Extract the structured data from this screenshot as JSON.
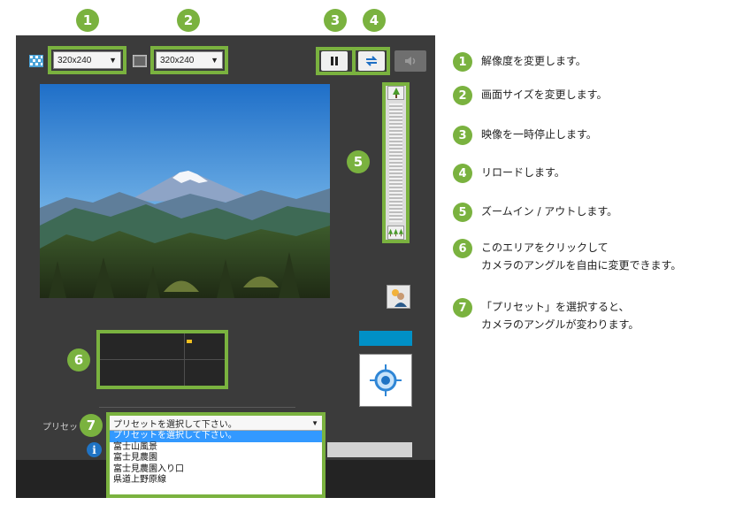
{
  "colors": {
    "accent": "#7ab23f",
    "panel": "#3b3b3b",
    "preset_highlight": "#3399ff",
    "status_bar": "#0090c6"
  },
  "badges": [
    "1",
    "2",
    "3",
    "4",
    "5",
    "6",
    "7"
  ],
  "toolbar": {
    "resolution_value": "320x240",
    "screen_size_value": "320x240",
    "pause_icon": "pause-icon",
    "reload_icon": "reload-icon",
    "sound_icon": "speaker-icon"
  },
  "zoom": {
    "in_icon": "single-tree-icon",
    "out_icon": "three-trees-icon"
  },
  "preset": {
    "label": "プリセット：",
    "selected": "プリセットを選択して下さい。",
    "options": [
      "プリセットを選択して下さい。",
      "富士山風景",
      "富士見農園",
      "富士見農園入り口",
      "県道上野原線"
    ]
  },
  "side_icons": {
    "camera_person": "camera-user-icon",
    "target": "target-icon",
    "info": "info-icon"
  },
  "legend": [
    {
      "num": "1",
      "text": "解像度を変更します。"
    },
    {
      "num": "2",
      "text": "画面サイズを変更します。"
    },
    {
      "num": "3",
      "text": "映像を一時停止します。"
    },
    {
      "num": "4",
      "text": "リロードします。"
    },
    {
      "num": "5",
      "text": "ズームイン / アウトします。"
    },
    {
      "num": "6",
      "text": "このエリアをクリックして",
      "text2": "カメラのアングルを自由に変更できます。"
    },
    {
      "num": "7",
      "text": "「プリセット」を選択すると、",
      "text2": "カメラのアングルが変わります。"
    }
  ]
}
